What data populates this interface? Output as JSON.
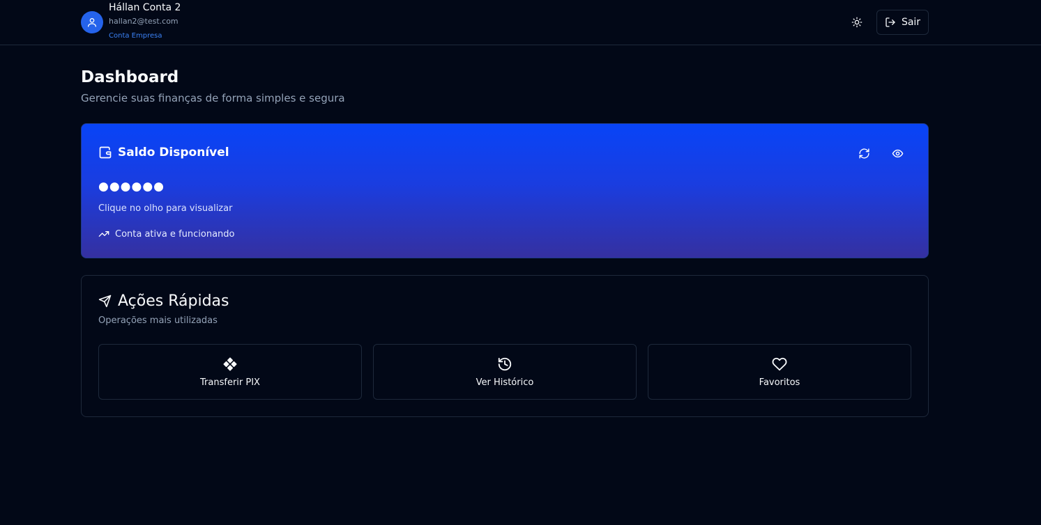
{
  "header": {
    "user_name": "Hállan Conta 2",
    "user_email": "hallan2@test.com",
    "account_type": "Conta Empresa",
    "logout_label": "Sair",
    "avatar_icon": "user-icon",
    "theme_icon": "sun-icon",
    "logout_icon": "log-out-icon"
  },
  "page": {
    "title": "Dashboard",
    "subtitle": "Gerencie suas finanças de forma simples e segura"
  },
  "balance": {
    "title": "Saldo Disponível",
    "masked_value": "●●●●●●",
    "hint": "Clique no olho para visualizar",
    "status": "Conta ativa e funcionando",
    "icons": [
      "wallet-icon",
      "refresh-icon",
      "eye-icon",
      "trending-up-icon"
    ]
  },
  "quick_actions": {
    "title": "Ações Rápidas",
    "subtitle": "Operações mais utilizadas",
    "items": [
      {
        "label": "Transferir PIX",
        "icon": "pix-icon"
      },
      {
        "label": "Ver Histórico",
        "icon": "history-icon"
      },
      {
        "label": "Favoritos",
        "icon": "heart-icon"
      }
    ]
  },
  "colors": {
    "background": "#020817",
    "border": "#1e293b",
    "accent": "#2563eb",
    "card_gradient_top": "#0844f7",
    "card_gradient_bottom": "#3530a0",
    "muted_text": "#94a3b8"
  }
}
